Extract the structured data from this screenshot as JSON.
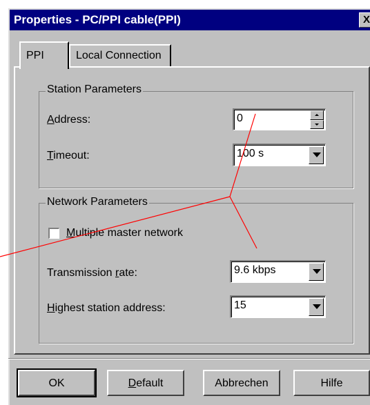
{
  "window": {
    "title": "Properties - PC/PPI cable(PPI)",
    "close_label": "X"
  },
  "tabs": [
    {
      "label": "PPI",
      "active": true
    },
    {
      "label": "Local Connection",
      "active": false
    }
  ],
  "station_group": {
    "legend": "Station Parameters",
    "address": {
      "label_accel": "A",
      "label_rest": "ddress:",
      "value": "0"
    },
    "timeout": {
      "label_accel": "T",
      "label_rest": "imeout:",
      "value": "100 s"
    }
  },
  "network_group": {
    "legend": "Network Parameters",
    "multi_master": {
      "label_accel": "M",
      "label_rest": "ultiple master network",
      "checked": false
    },
    "transmission": {
      "label_pre": "Transmission ",
      "label_accel": "r",
      "label_rest": "ate:",
      "value": "9.6 kbps"
    },
    "highest": {
      "label_accel": "H",
      "label_rest": "ighest station address:",
      "value": "15"
    }
  },
  "buttons": {
    "ok": "OK",
    "default_accel": "D",
    "default_rest": "efault",
    "cancel": "Abbrechen",
    "help": "Hilfe"
  },
  "colors": {
    "titlebar": "#000080",
    "face": "#c0c0c0",
    "annotation": "#ff0000"
  }
}
